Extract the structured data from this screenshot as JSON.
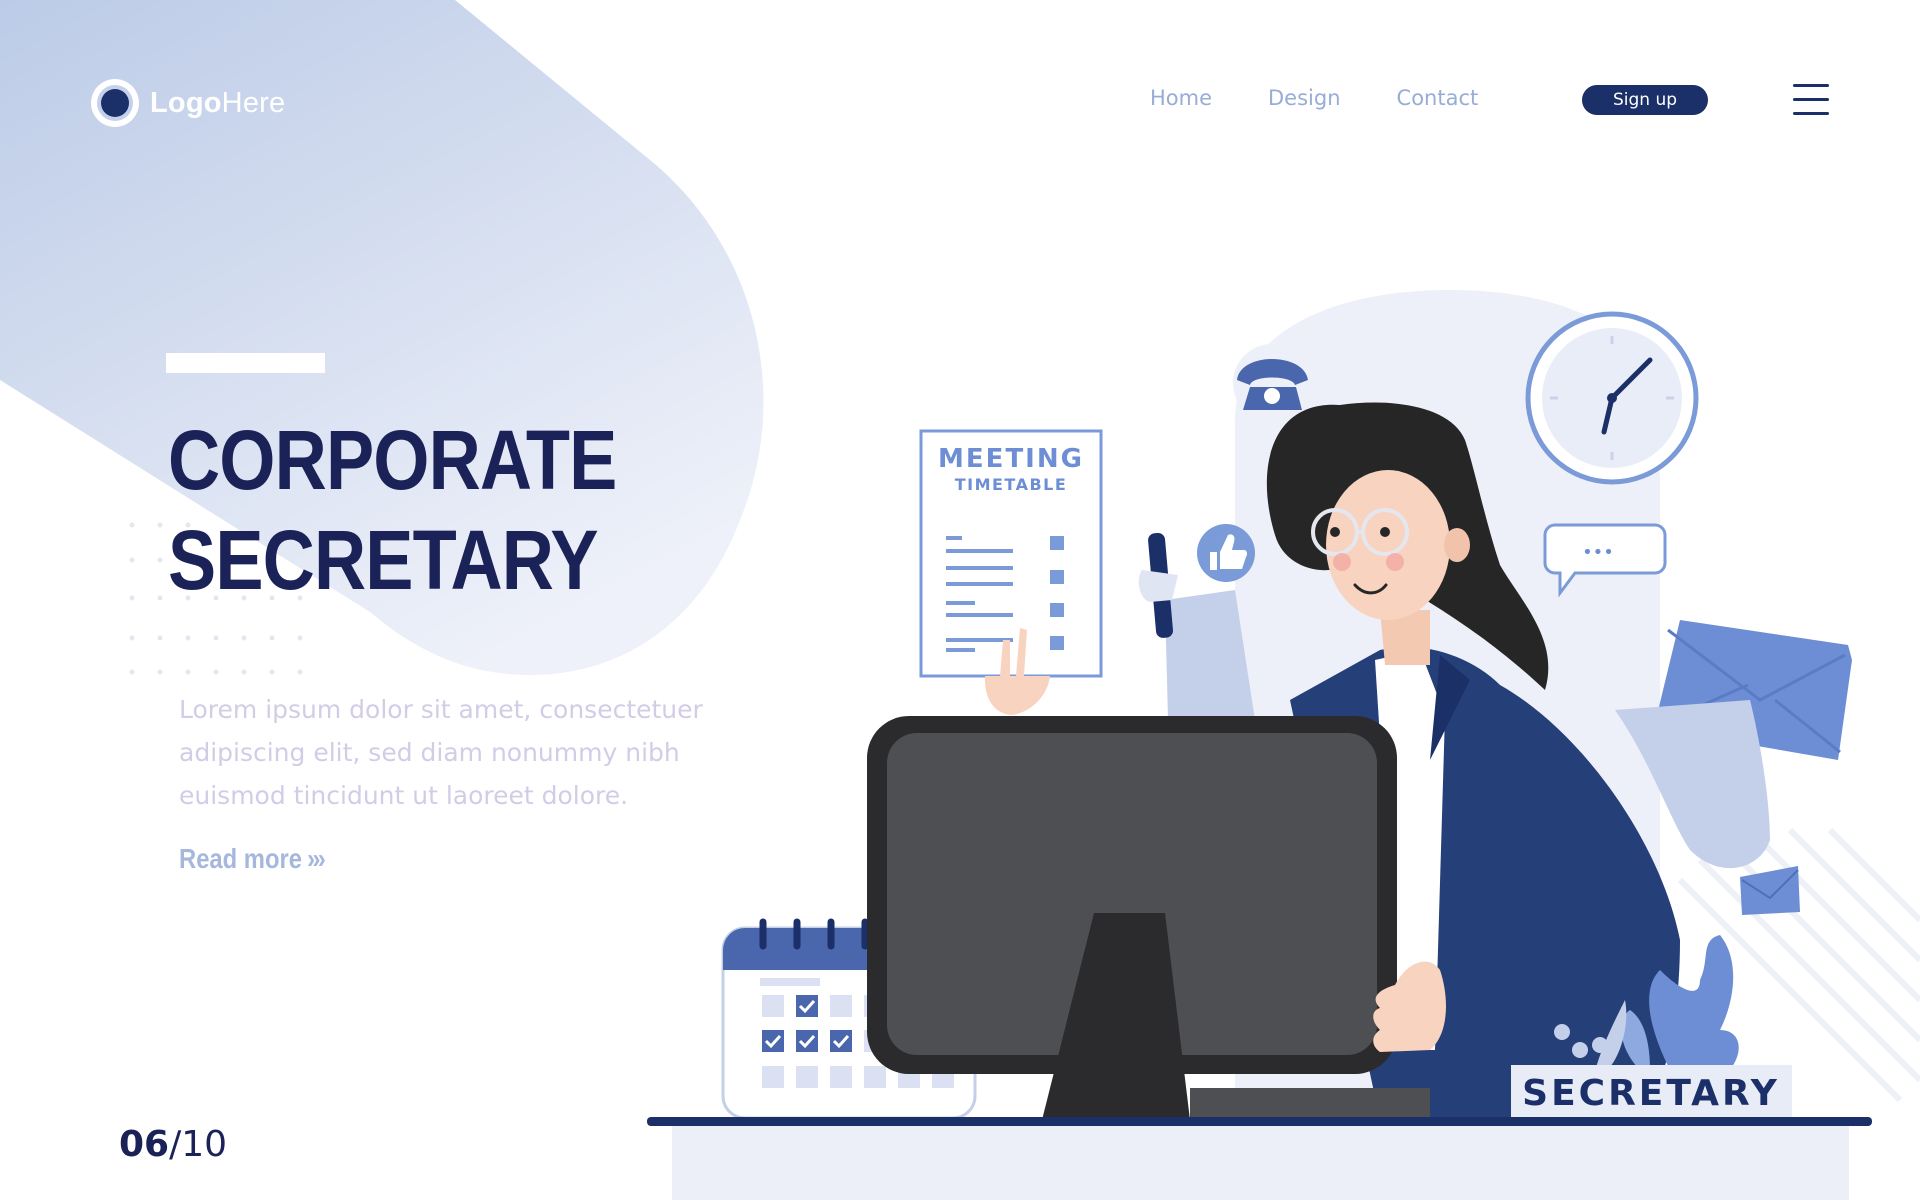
{
  "header": {
    "logo_bold": "Logo",
    "logo_light": "Here",
    "nav": [
      "Home",
      "Design",
      "Contact"
    ],
    "signup_label": "Sign up"
  },
  "hero": {
    "title_line1": "CORPORATE",
    "title_line2": "SECRETARY",
    "body": "Lorem ipsum dolor sit amet, consectetuer adipiscing elit, sed diam nonummy nibh euismod tincidunt ut laoreet dolore.",
    "read_more": "Read more",
    "read_more_arrows": "›››"
  },
  "pager": {
    "current": "06",
    "total": "/10"
  },
  "illustration": {
    "doc_title": "MEETING",
    "doc_subtitle": "TIMETABLE",
    "nameplate": "SECRETARY",
    "chat_dots": "•••"
  },
  "colors": {
    "navy": "#1b2258",
    "button": "#1b2f68",
    "accent_blue": "#6d8ed4",
    "light_blue": "#c9d4ec",
    "jacket": "#253f78",
    "monitor": "#2b2b2d"
  }
}
